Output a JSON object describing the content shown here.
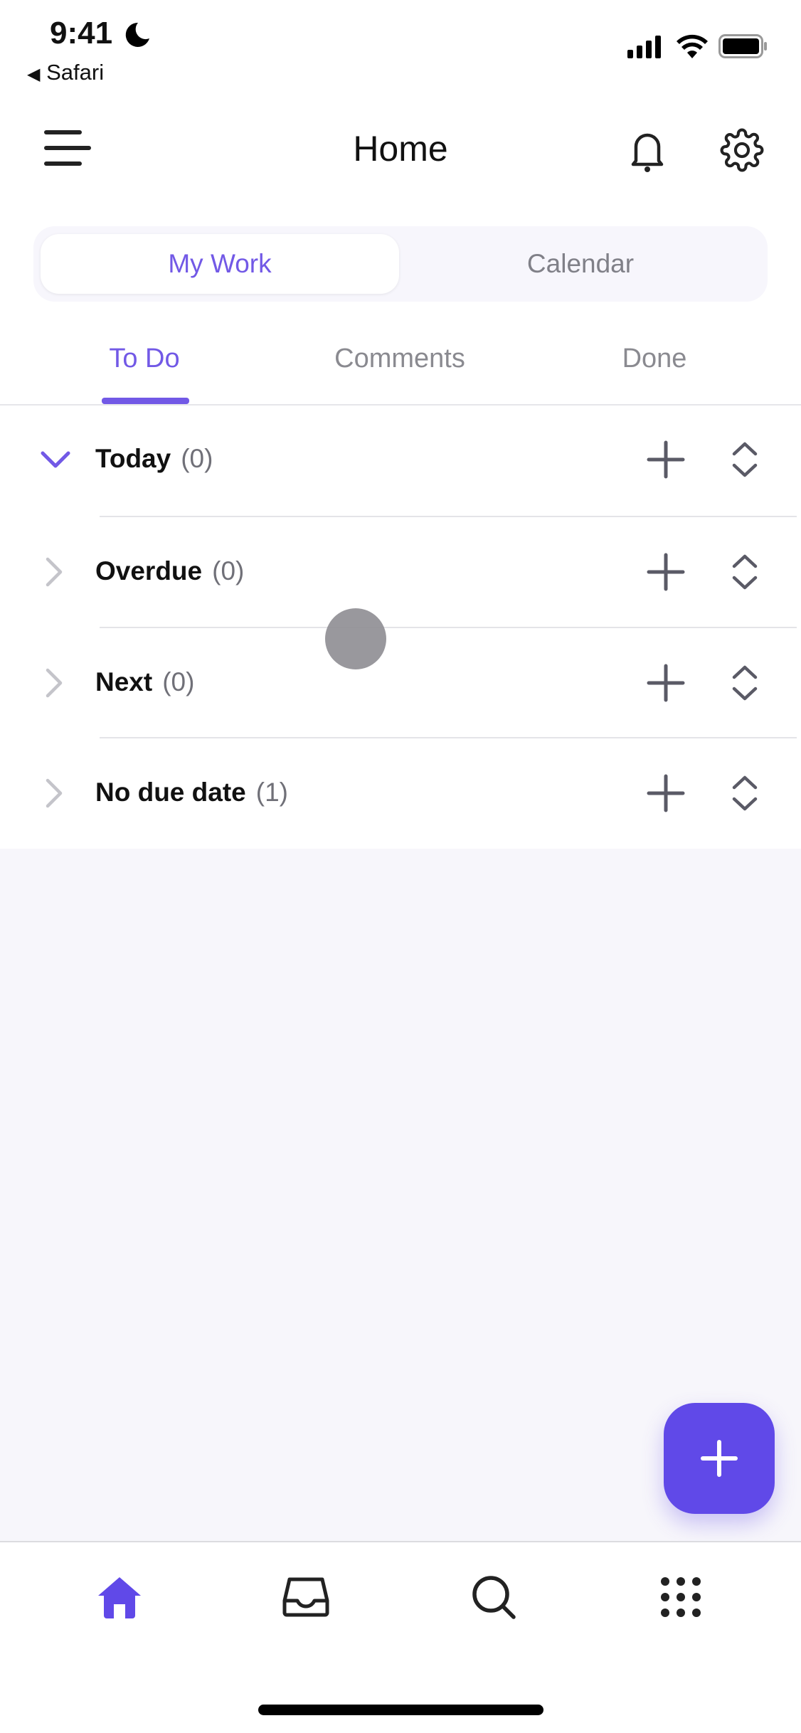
{
  "status_bar": {
    "time": "9:41",
    "back_label": "Safari"
  },
  "header": {
    "title": "Home"
  },
  "segmented": {
    "options": [
      "My Work",
      "Calendar"
    ],
    "selected": "My Work"
  },
  "tabs": [
    {
      "label": "To Do",
      "active": true
    },
    {
      "label": "Comments",
      "active": false
    },
    {
      "label": "Done",
      "active": false
    }
  ],
  "groups": [
    {
      "title": "Today",
      "count": "(0)",
      "expanded": true
    },
    {
      "title": "Overdue",
      "count": "(0)",
      "expanded": false
    },
    {
      "title": "Next",
      "count": "(0)",
      "expanded": false
    },
    {
      "title": "No due date",
      "count": "(1)",
      "expanded": false
    }
  ],
  "bottom_nav": [
    {
      "icon": "home-icon",
      "active": true
    },
    {
      "icon": "inbox-icon"
    },
    {
      "icon": "search-icon"
    },
    {
      "icon": "apps-grid-icon"
    }
  ],
  "colors": {
    "accent": "#6049e8",
    "tab_accent": "#7259e6",
    "background": "#f7f6fb"
  }
}
